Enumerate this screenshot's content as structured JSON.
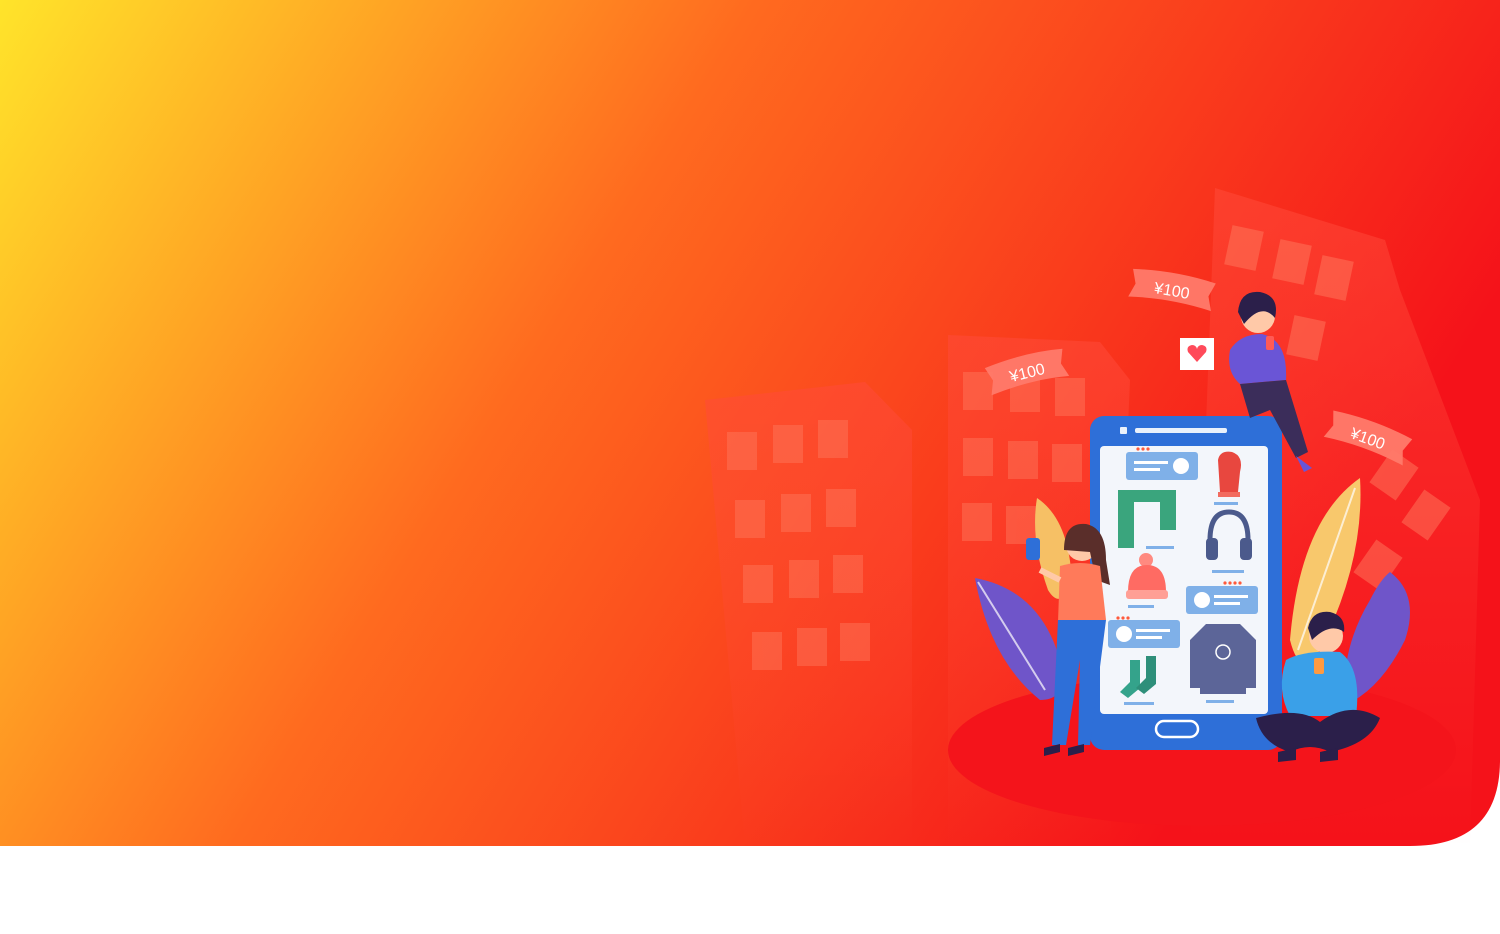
{
  "banner": {
    "gradient_start": "#ffe42a",
    "gradient_mid": "#ff6a1f",
    "gradient_end": "#f5121a",
    "footer_color": "#ffffff"
  },
  "price_tags": [
    {
      "name": "price-tag-left",
      "text": "¥100"
    },
    {
      "name": "price-tag-top",
      "text": "¥100"
    },
    {
      "name": "price-tag-right",
      "text": "¥100"
    }
  ],
  "products": [
    {
      "name": "mittens-icon",
      "color": "#e8473f"
    },
    {
      "name": "scarf-icon",
      "color": "#3aa57d"
    },
    {
      "name": "earmuffs-icon",
      "color": "#4b5a8c"
    },
    {
      "name": "beanie-icon",
      "color": "#ff6b63"
    },
    {
      "name": "sweater-icon",
      "color": "#5c6598"
    },
    {
      "name": "socks-icon",
      "color": "#34a38b"
    }
  ],
  "colors": {
    "phone_frame": "#2e6fd8",
    "phone_screen": "#f3f6fb",
    "bubble": "#7fb0e8",
    "star": "#ff5a3c",
    "building": "#ff4a3a",
    "floor_ellipse": "#f4141b"
  }
}
